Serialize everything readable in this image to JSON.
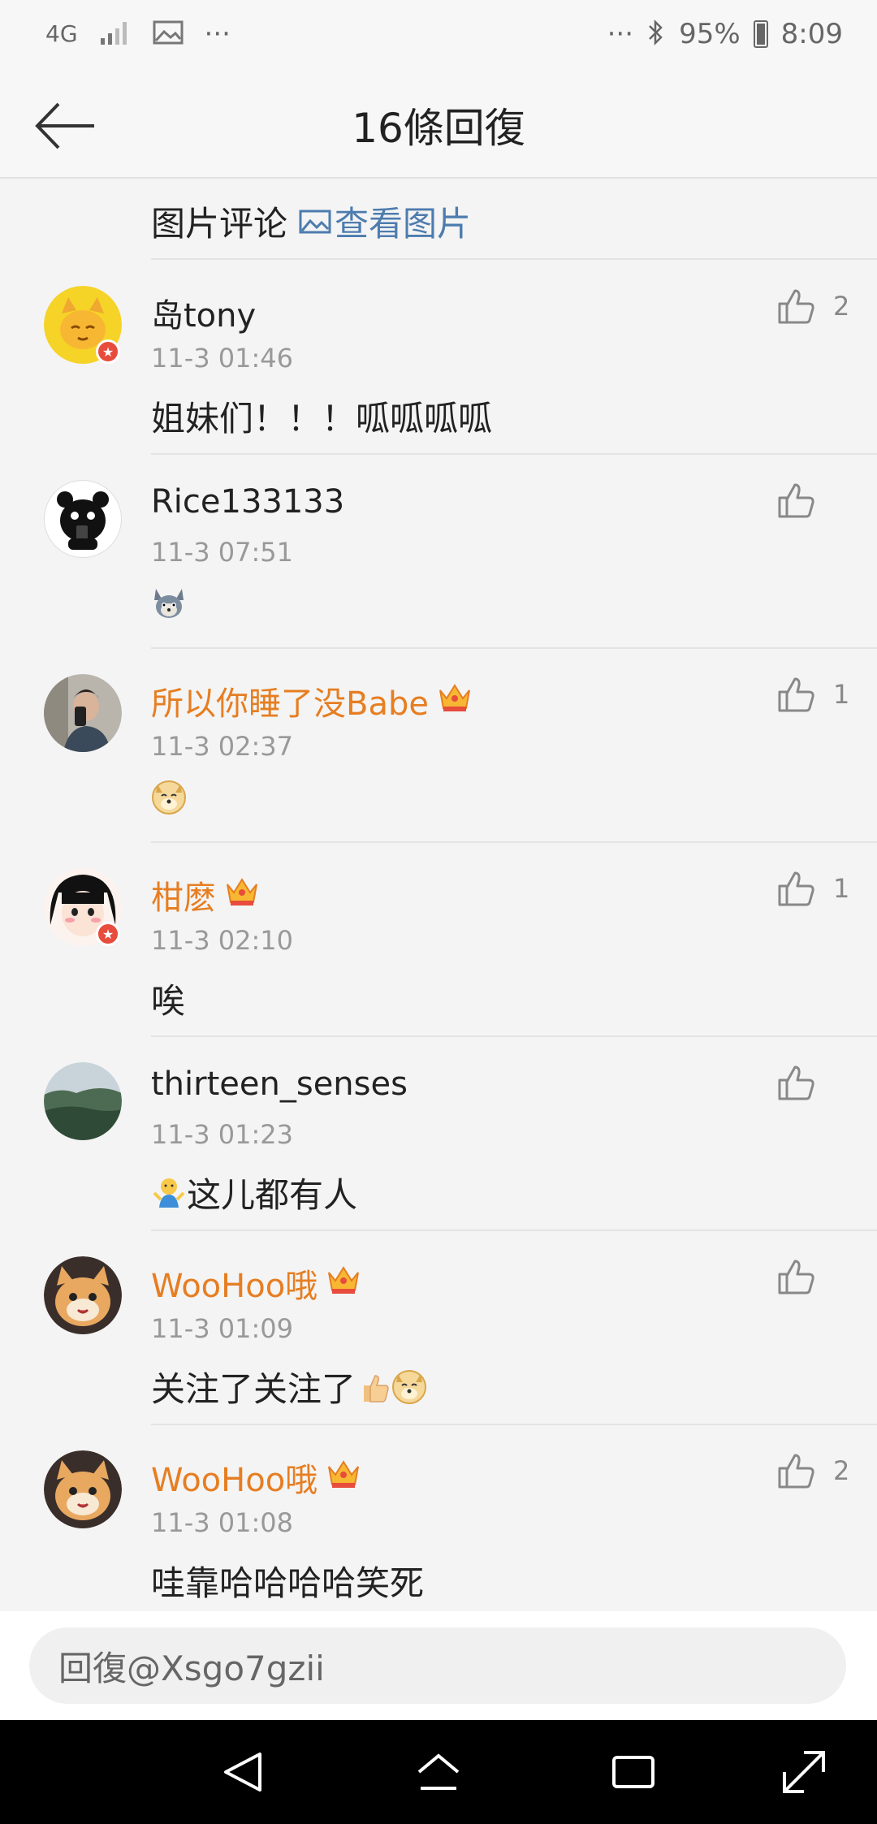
{
  "status_bar": {
    "network": "4G",
    "overflow": "···",
    "battery_pct": "95%",
    "time": "8:09"
  },
  "header": {
    "title": "16條回復"
  },
  "pic_comment": {
    "label": "图片评论",
    "link": "查看图片"
  },
  "comments": [
    {
      "user": "岛tony",
      "time": "11-3 01:46",
      "text": "姐妹们！！！呱呱呱呱",
      "likes": "2",
      "vip": false
    },
    {
      "user": "Rice133133",
      "time": "11-3 07:51",
      "text": "",
      "likes": "",
      "vip": false
    },
    {
      "user": "所以你睡了没Babe",
      "time": "11-3 02:37",
      "text": "",
      "likes": "1",
      "vip": true
    },
    {
      "user": "柑麽",
      "time": "11-3 02:10",
      "text": "唉",
      "likes": "1",
      "vip": true
    },
    {
      "user": "thirteen_senses",
      "time": "11-3 01:23",
      "text": "这儿都有人",
      "likes": "",
      "vip": false
    },
    {
      "user": "WooHoo哦",
      "time": "11-3 01:09",
      "text": "关注了关注了",
      "likes": "",
      "vip": true
    },
    {
      "user": "WooHoo哦",
      "time": "11-3 01:08",
      "text": "哇靠哈哈哈哈笑死",
      "likes": "2",
      "vip": true
    }
  ],
  "reply": {
    "placeholder": "回復@Xsgo7gzii"
  },
  "colors": {
    "vip_name": "#e67e22",
    "link": "#4d7cae",
    "timestamp": "#999999"
  }
}
